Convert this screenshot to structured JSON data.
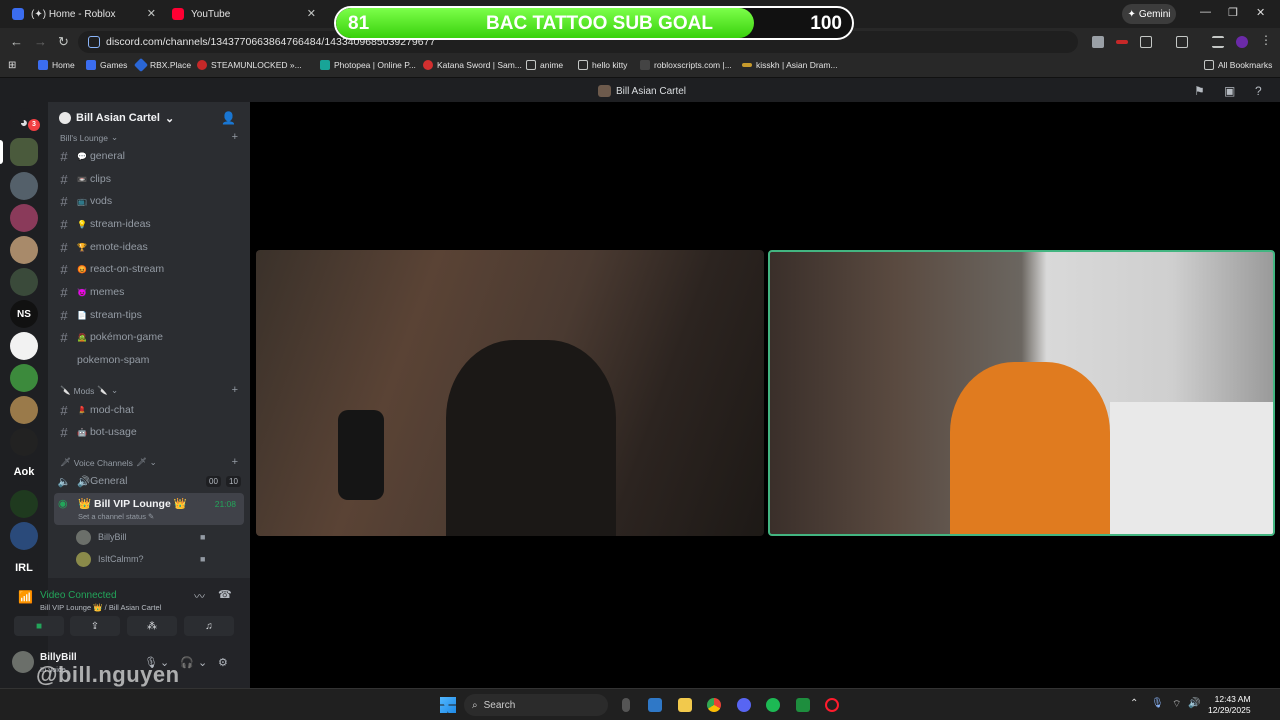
{
  "browser": {
    "tabs": [
      {
        "title": "(✦) Home - Roblox",
        "color": "#3b6df0"
      },
      {
        "title": "YouTube",
        "color": "#ff0033"
      }
    ],
    "gemini_label": "Gemini",
    "url": "discord.com/channels/1343770663864766484/1433409685039279677",
    "bookmarks": [
      "Home",
      "Games",
      "RBX.Place",
      "STEAMUNLOCKED »...",
      "Photopea | Online P...",
      "Katana Sword | Sam...",
      "anime",
      "hello kitty",
      "robloxscripts.com |...",
      "kisskh | Asian Dram..."
    ],
    "all_bookmarks": "All Bookmarks"
  },
  "goal": {
    "current": "81",
    "title": "BAC TATTOO SUB GOAL",
    "max": "100",
    "fraction": 0.81
  },
  "discord": {
    "window_title": "Bill Asian Cartel",
    "guild_badge": "3",
    "guild_labels": [
      "NS",
      "Aok",
      "IRL"
    ],
    "server_name": "Bill Asian Cartel",
    "categories": {
      "lounge": "Bill's Lounge",
      "mods": "Mods",
      "voice": "Voice Channels"
    },
    "lounge_channels": [
      {
        "emoji": "💬",
        "name": "general"
      },
      {
        "emoji": "📼",
        "name": "clips"
      },
      {
        "emoji": "📺",
        "name": "vods"
      },
      {
        "emoji": "💡",
        "name": "stream-ideas"
      },
      {
        "emoji": "🏆",
        "name": "emote-ideas"
      },
      {
        "emoji": "😡",
        "name": "react-on-stream"
      },
      {
        "emoji": "😈",
        "name": "memes"
      },
      {
        "emoji": "📄",
        "name": "stream-tips"
      },
      {
        "emoji": "🧟",
        "name": "pokémon-game"
      },
      {
        "emoji": "",
        "name": "pokemon-spam"
      }
    ],
    "mod_channels": [
      {
        "emoji": "💄",
        "name": "mod-chat"
      },
      {
        "emoji": "🤖",
        "name": "bot-usage"
      }
    ],
    "voice_channels": {
      "general": {
        "name": "General",
        "count_a": "00",
        "count_b": "10"
      },
      "vip": {
        "name": "Bill VIP Lounge",
        "time": "21:08",
        "status_hint": "Set a channel status"
      }
    },
    "voice_users": [
      "BillyBill",
      "IsItCalmm?"
    ],
    "voice_panel": {
      "status": "Video Connected",
      "location": "Bill VIP Lounge 👑 / Bill Asian Cartel"
    },
    "user": {
      "name": "BillyBill",
      "status": "In voice"
    }
  },
  "watermark": "@bill.nguyen",
  "taskbar": {
    "search_placeholder": "Search",
    "time": "12:43 AM",
    "date": "12/29/2025"
  }
}
